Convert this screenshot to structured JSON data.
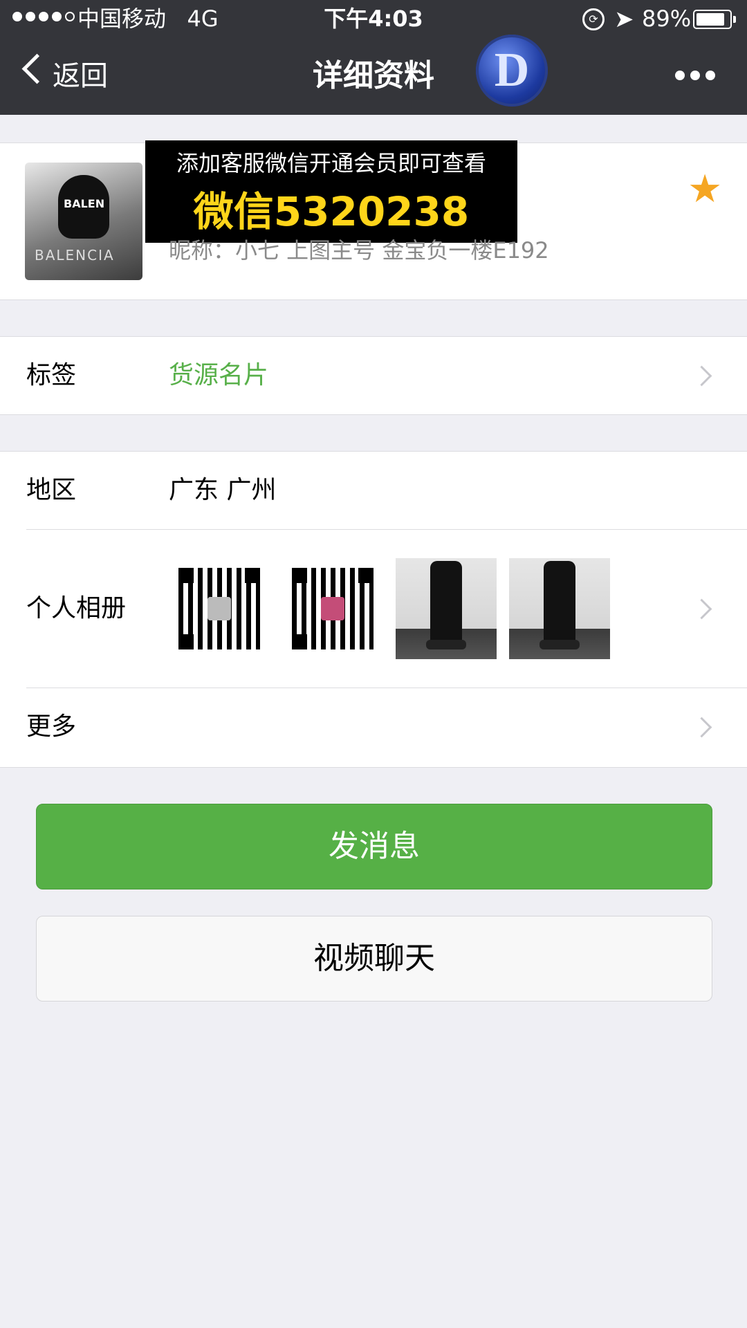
{
  "status_bar": {
    "carrier": "中国移动",
    "network": "4G",
    "time": "下午4:03",
    "battery": "89%",
    "battery_level": 0.89
  },
  "nav": {
    "back_label": "返回",
    "title": "详细资料",
    "logo_letter": "D",
    "more_icon": "ellipsis-icon"
  },
  "profile": {
    "banner_line1": "添加客服微信开通会员即可查看",
    "banner_line2": "微信5320238",
    "nickname": "昵称：小七 上图主号 金宝负一楼E192",
    "avatar_hood_text": "BALEN",
    "avatar_body_text": "BALENCIA",
    "star_icon": "star-icon"
  },
  "tags": {
    "label": "标签",
    "value": "货源名片"
  },
  "region": {
    "label": "地区",
    "value": "广东 广州"
  },
  "album": {
    "label": "个人相册",
    "photos": [
      "qr-code",
      "qr-code",
      "pants-photo",
      "pants-photo"
    ]
  },
  "more": {
    "label": "更多"
  },
  "actions": {
    "send_message": "发消息",
    "video_chat": "视频聊天"
  },
  "colors": {
    "nav_bg": "#34353a",
    "accent_green": "#56b046",
    "tag_green": "#58b04a",
    "star": "#f5a623"
  }
}
